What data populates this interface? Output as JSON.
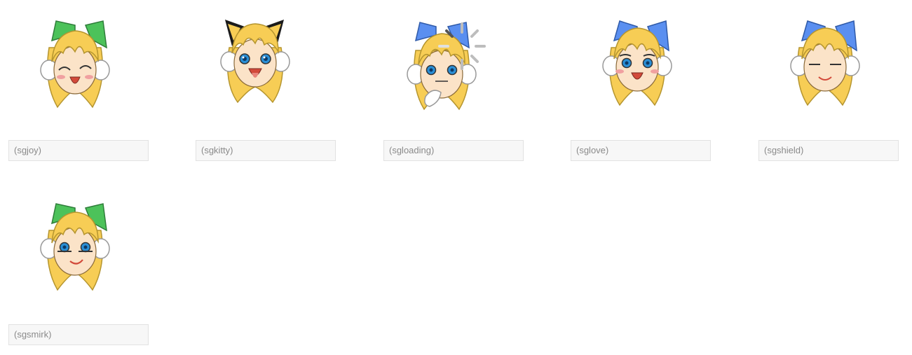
{
  "palette": {
    "hair": "#f7cd55",
    "hair_stroke": "#b5952f",
    "skin": "#fbe3c8",
    "blush": "#f0a0a0",
    "outline": "#5a4a2a",
    "eye": "#2a8fd6",
    "mouth": "#d24a3a",
    "earmuff": "#ffffff",
    "green_bow": "#4cc25a",
    "blue_bow": "#5a8ff0",
    "kitty_ears": "#1b1b1b"
  },
  "emoticons": [
    {
      "code": "(sgjoy)",
      "accessory": "green-bow",
      "expression": "wink-open-mouth"
    },
    {
      "code": "(sgkitty)",
      "accessory": "kitty-ears",
      "expression": "open-eyes-tongue"
    },
    {
      "code": "(sgloading)",
      "accessory": "blue-bow",
      "expression": "loading-spinner"
    },
    {
      "code": "(sglove)",
      "accessory": "blue-bow",
      "expression": "open-eyes-open-mouth"
    },
    {
      "code": "(sgshield)",
      "accessory": "blue-bow",
      "expression": "closed-eyes-smile"
    },
    {
      "code": "(sgsmirk)",
      "accessory": "green-bow",
      "expression": "half-eyes-smirk"
    }
  ]
}
